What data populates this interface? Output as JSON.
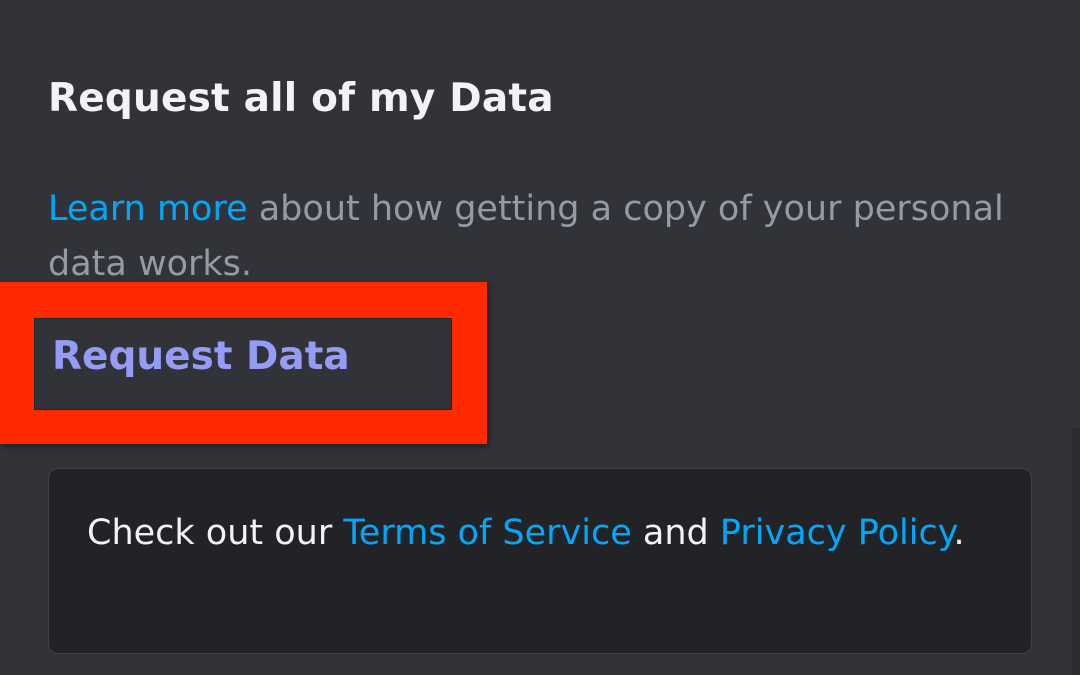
{
  "section": {
    "title": "Request all of my Data"
  },
  "description": {
    "link_text": "Learn more",
    "text": " about how getting a copy of your personal data works."
  },
  "request_button": {
    "label": "Request Data"
  },
  "info_card": {
    "prefix": "Check out our ",
    "terms_link": "Terms of Service",
    "middle": " and ",
    "privacy_link": "Privacy Policy",
    "suffix": "."
  },
  "colors": {
    "background": "#313338",
    "link": "#00a8fc",
    "button_text": "#949cf7",
    "highlight": "#ff2a00",
    "card_background": "#222327"
  }
}
